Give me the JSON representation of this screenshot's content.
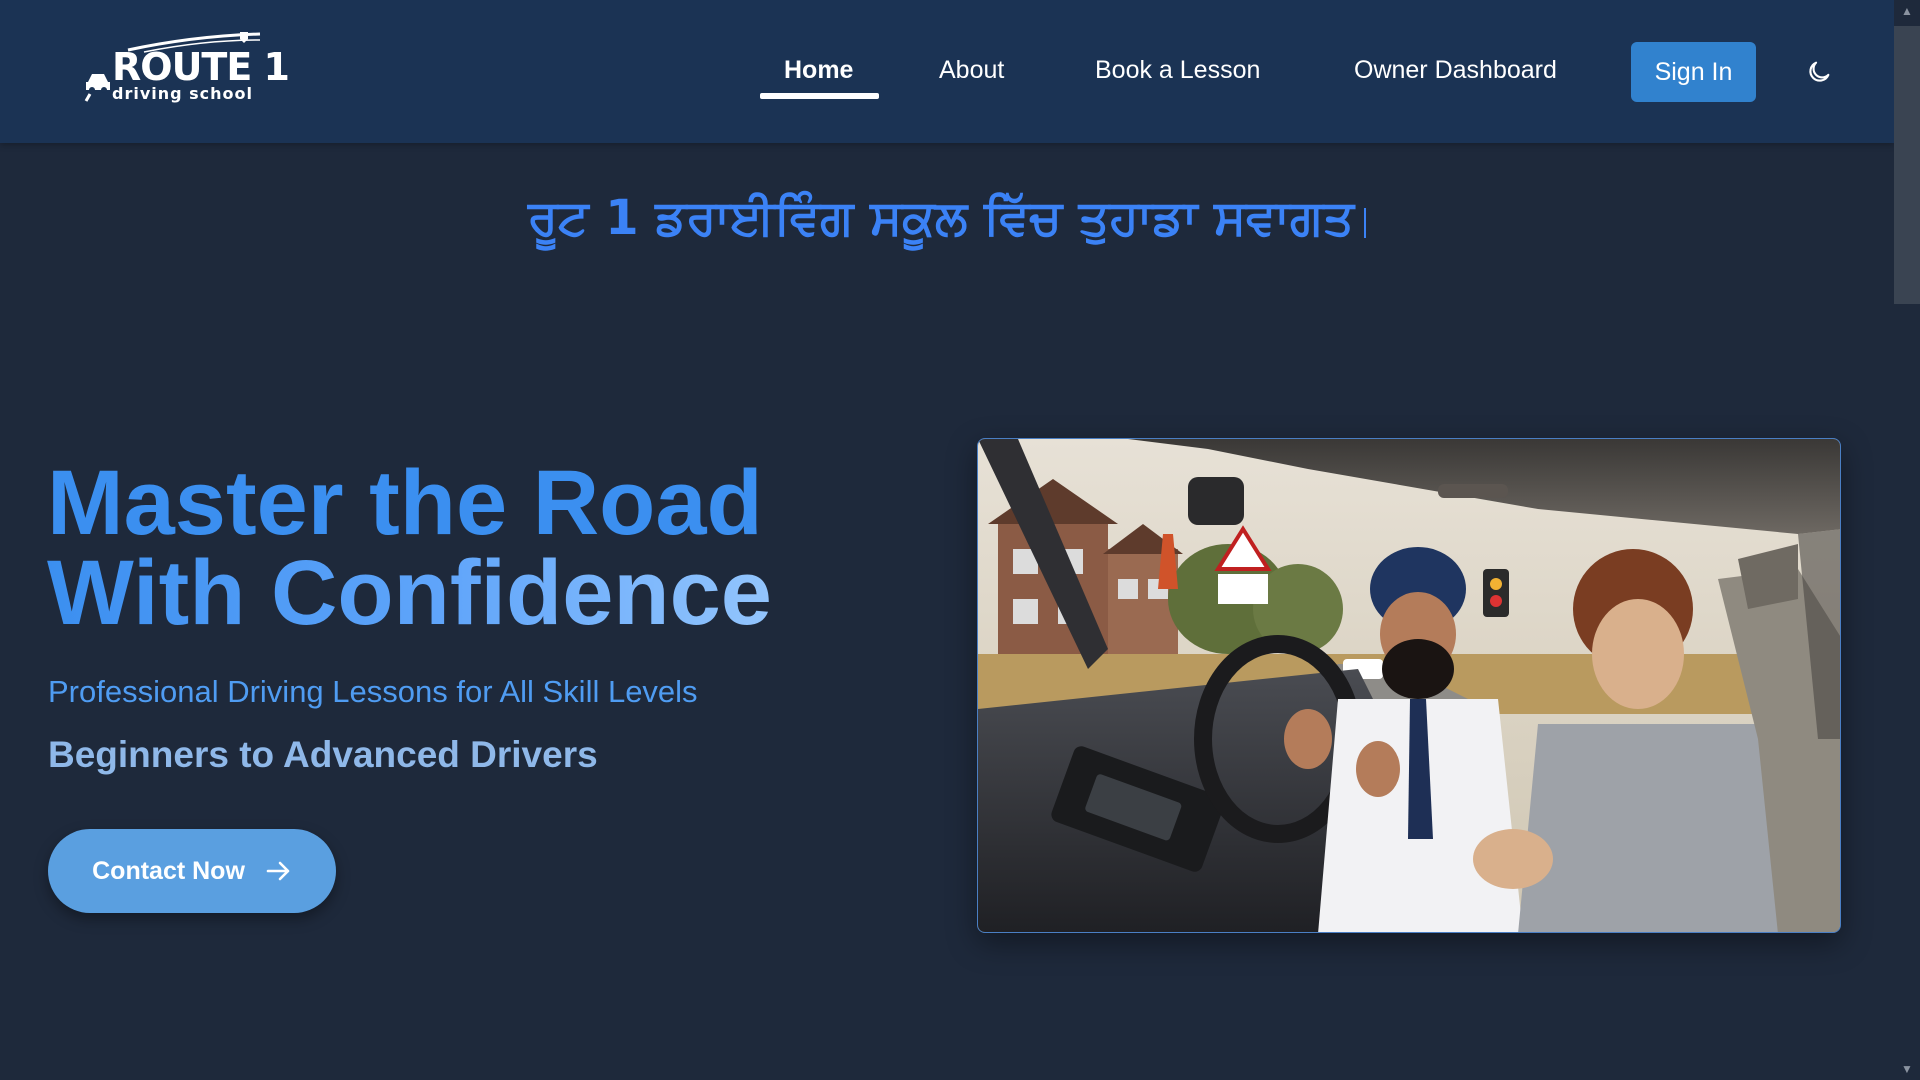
{
  "brand": {
    "name": "ROUTE 1",
    "tagline": "driving school"
  },
  "nav": {
    "items": [
      {
        "label": "Home",
        "active": true
      },
      {
        "label": "About",
        "active": false
      },
      {
        "label": "Book a Lesson",
        "active": false
      },
      {
        "label": "Owner Dashboard",
        "active": false
      }
    ],
    "signin_label": "Sign In",
    "theme_icon": "moon-icon"
  },
  "welcome_text": "ਰੂਟ 1 ਡਰਾਈਵਿੰਗ ਸਕੂਲ ਵਿੱਚ ਤੁਹਾਡਾ ਸਵਾਗਤ",
  "hero": {
    "title_line1": "Master the Road",
    "title_line2": "With Confidence",
    "subtitle": "Professional Driving Lessons for All Skill Levels",
    "subtitle2": "Beginners to Advanced Drivers",
    "cta_label": "Contact Now",
    "cta_icon": "arrow-right-icon"
  },
  "colors": {
    "header_bg": "#1b3354",
    "page_bg": "#1e293b",
    "accent": "#3182ce",
    "title_blue": "#3b8ff0",
    "cta_bg": "#5a9fe0"
  }
}
